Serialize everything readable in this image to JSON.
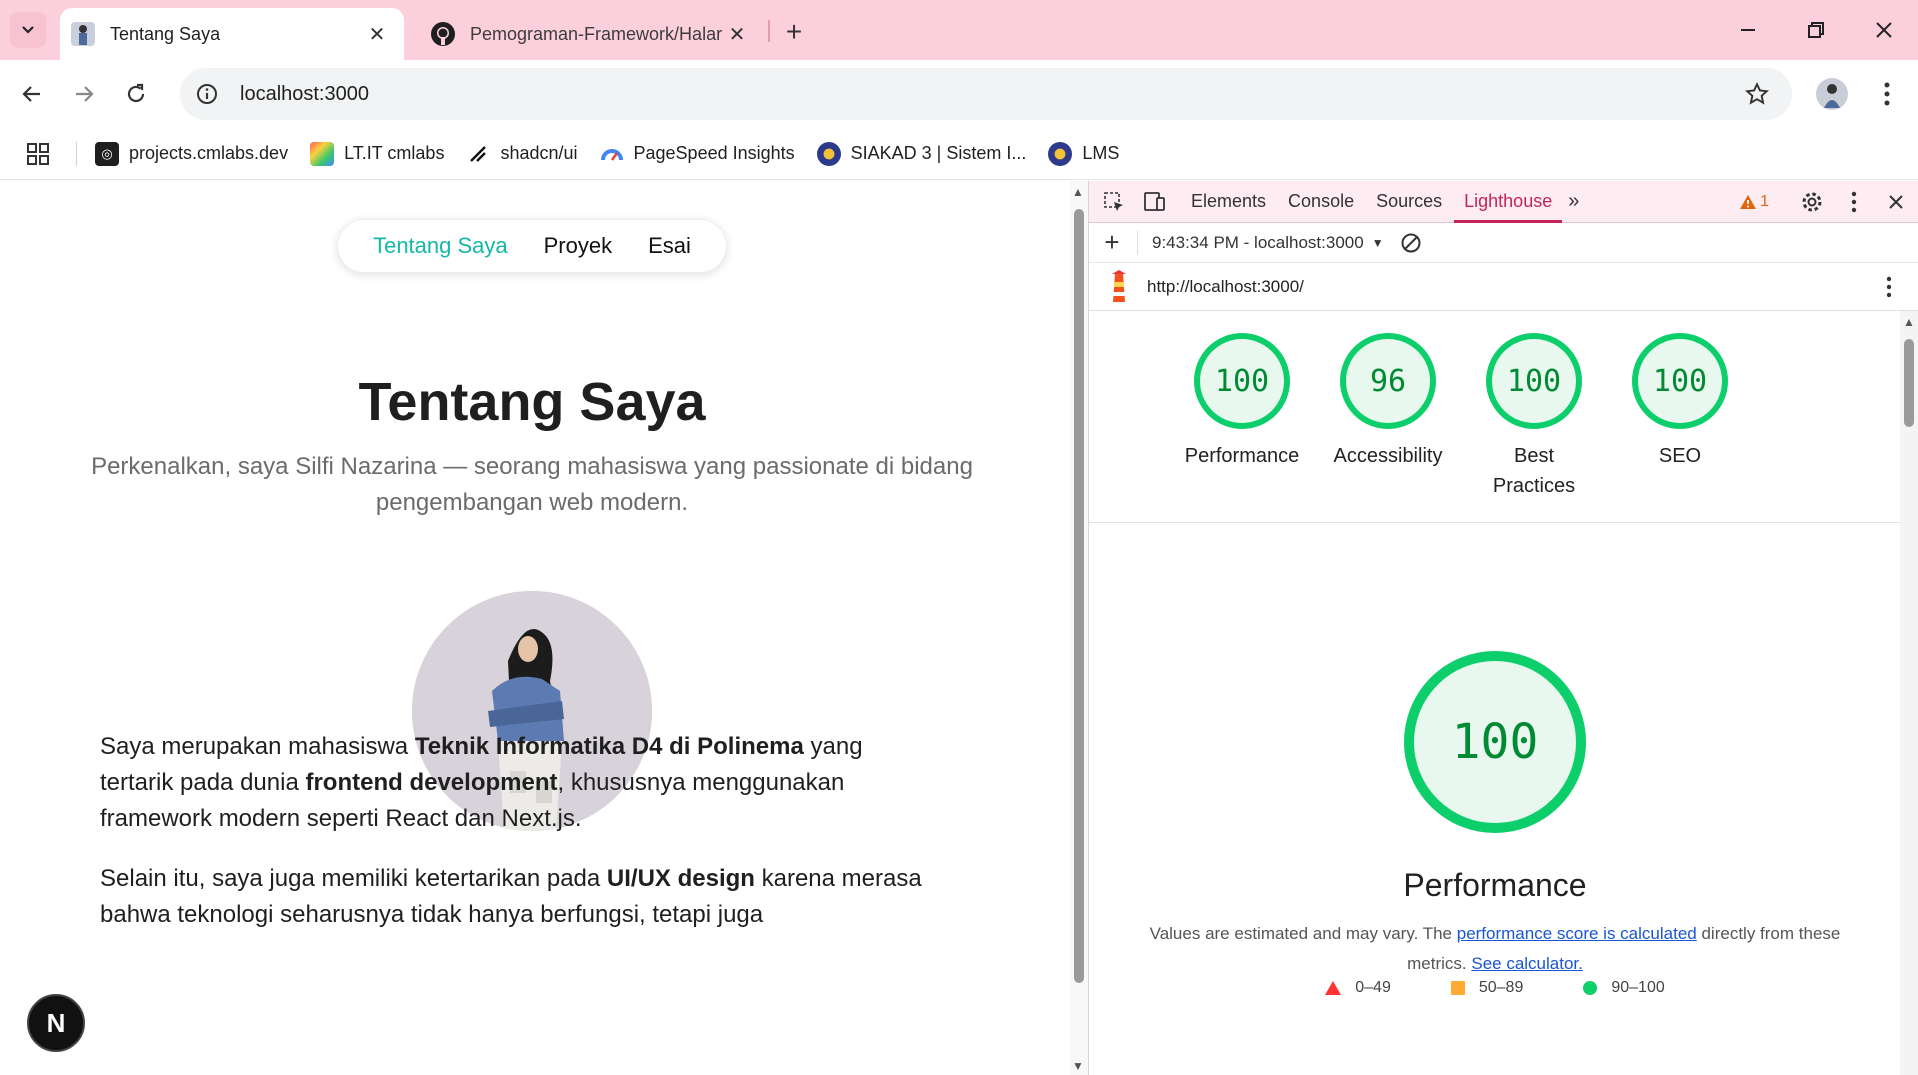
{
  "browser": {
    "tabs": [
      {
        "title": "Tentang Saya",
        "active": true
      },
      {
        "title": "Pemograman-Framework/Halar",
        "active": false
      }
    ],
    "url": "localhost:3000",
    "bookmarks": [
      {
        "label": "projects.cmlabs.dev",
        "icon": "cmlabs-icon"
      },
      {
        "label": "LT.IT cmlabs",
        "icon": "lt-icon"
      },
      {
        "label": "shadcn/ui",
        "icon": "shadcn-icon"
      },
      {
        "label": "PageSpeed Insights",
        "icon": "pagespeed-icon"
      },
      {
        "label": "SIAKAD 3 | Sistem I...",
        "icon": "siakad-icon"
      },
      {
        "label": "LMS",
        "icon": "lms-icon"
      }
    ]
  },
  "site": {
    "nav": [
      "Tentang Saya",
      "Proyek",
      "Esai"
    ],
    "title": "Tentang Saya",
    "subtitle": "Perkenalkan, saya Silfi Nazarina — seorang mahasiswa yang passionate di bidang pengembangan web modern.",
    "para1": {
      "t1": "Saya merupakan mahasiswa ",
      "b1": "Teknik Informatika D4 di Polinema",
      "t2": " yang tertarik pada dunia ",
      "b2": "frontend development",
      "t3": ", khususnya menggunakan framework modern seperti React dan Next.js."
    },
    "para2": {
      "t1": "Selain itu, saya juga memiliki ketertarikan pada ",
      "b1": "UI/UX design",
      "t2": " karena merasa bahwa teknologi seharusnya tidak hanya berfungsi, tetapi juga"
    },
    "next_badge": "N"
  },
  "devtools": {
    "tabs": [
      "Elements",
      "Console",
      "Sources",
      "Lighthouse"
    ],
    "selected_tab": "Lighthouse",
    "more": "»",
    "warning_count": "1",
    "report_label": "9:43:34 PM - localhost:3000",
    "report_url": "http://localhost:3000/",
    "scores": [
      {
        "value": "100",
        "label": "Performance"
      },
      {
        "value": "96",
        "label": "Accessibility"
      },
      {
        "value": "100",
        "label": "Best Practices"
      },
      {
        "value": "100",
        "label": "SEO"
      }
    ],
    "perf_score": "100",
    "perf_title": "Performance",
    "note": {
      "t1": "Values are estimated and may vary. The ",
      "link1": "performance score is calculated",
      "t2": " directly from these metrics. ",
      "link2": "See calculator."
    },
    "legend": [
      "0–49",
      "50–89",
      "90–100"
    ],
    "colors": {
      "pass": "#0cce6b",
      "average": "#ffaa33",
      "fail": "#ff3333",
      "accent": "#c4245c"
    }
  }
}
